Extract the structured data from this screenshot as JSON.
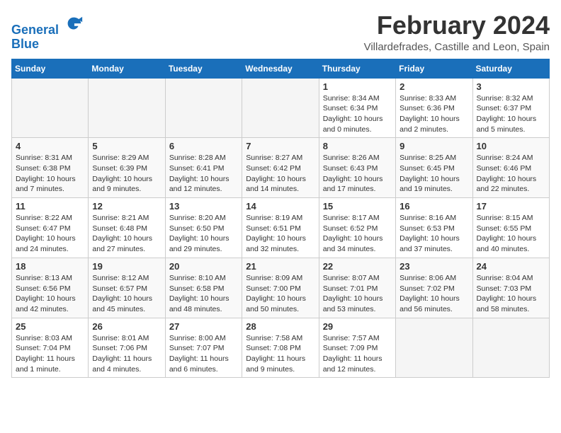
{
  "logo": {
    "line1": "General",
    "line2": "Blue"
  },
  "title": "February 2024",
  "subtitle": "Villardefrades, Castille and Leon, Spain",
  "weekdays": [
    "Sunday",
    "Monday",
    "Tuesday",
    "Wednesday",
    "Thursday",
    "Friday",
    "Saturday"
  ],
  "weeks": [
    [
      {
        "day": "",
        "info": ""
      },
      {
        "day": "",
        "info": ""
      },
      {
        "day": "",
        "info": ""
      },
      {
        "day": "",
        "info": ""
      },
      {
        "day": "1",
        "info": "Sunrise: 8:34 AM\nSunset: 6:34 PM\nDaylight: 10 hours and 0 minutes."
      },
      {
        "day": "2",
        "info": "Sunrise: 8:33 AM\nSunset: 6:36 PM\nDaylight: 10 hours and 2 minutes."
      },
      {
        "day": "3",
        "info": "Sunrise: 8:32 AM\nSunset: 6:37 PM\nDaylight: 10 hours and 5 minutes."
      }
    ],
    [
      {
        "day": "4",
        "info": "Sunrise: 8:31 AM\nSunset: 6:38 PM\nDaylight: 10 hours and 7 minutes."
      },
      {
        "day": "5",
        "info": "Sunrise: 8:29 AM\nSunset: 6:39 PM\nDaylight: 10 hours and 9 minutes."
      },
      {
        "day": "6",
        "info": "Sunrise: 8:28 AM\nSunset: 6:41 PM\nDaylight: 10 hours and 12 minutes."
      },
      {
        "day": "7",
        "info": "Sunrise: 8:27 AM\nSunset: 6:42 PM\nDaylight: 10 hours and 14 minutes."
      },
      {
        "day": "8",
        "info": "Sunrise: 8:26 AM\nSunset: 6:43 PM\nDaylight: 10 hours and 17 minutes."
      },
      {
        "day": "9",
        "info": "Sunrise: 8:25 AM\nSunset: 6:45 PM\nDaylight: 10 hours and 19 minutes."
      },
      {
        "day": "10",
        "info": "Sunrise: 8:24 AM\nSunset: 6:46 PM\nDaylight: 10 hours and 22 minutes."
      }
    ],
    [
      {
        "day": "11",
        "info": "Sunrise: 8:22 AM\nSunset: 6:47 PM\nDaylight: 10 hours and 24 minutes."
      },
      {
        "day": "12",
        "info": "Sunrise: 8:21 AM\nSunset: 6:48 PM\nDaylight: 10 hours and 27 minutes."
      },
      {
        "day": "13",
        "info": "Sunrise: 8:20 AM\nSunset: 6:50 PM\nDaylight: 10 hours and 29 minutes."
      },
      {
        "day": "14",
        "info": "Sunrise: 8:19 AM\nSunset: 6:51 PM\nDaylight: 10 hours and 32 minutes."
      },
      {
        "day": "15",
        "info": "Sunrise: 8:17 AM\nSunset: 6:52 PM\nDaylight: 10 hours and 34 minutes."
      },
      {
        "day": "16",
        "info": "Sunrise: 8:16 AM\nSunset: 6:53 PM\nDaylight: 10 hours and 37 minutes."
      },
      {
        "day": "17",
        "info": "Sunrise: 8:15 AM\nSunset: 6:55 PM\nDaylight: 10 hours and 40 minutes."
      }
    ],
    [
      {
        "day": "18",
        "info": "Sunrise: 8:13 AM\nSunset: 6:56 PM\nDaylight: 10 hours and 42 minutes."
      },
      {
        "day": "19",
        "info": "Sunrise: 8:12 AM\nSunset: 6:57 PM\nDaylight: 10 hours and 45 minutes."
      },
      {
        "day": "20",
        "info": "Sunrise: 8:10 AM\nSunset: 6:58 PM\nDaylight: 10 hours and 48 minutes."
      },
      {
        "day": "21",
        "info": "Sunrise: 8:09 AM\nSunset: 7:00 PM\nDaylight: 10 hours and 50 minutes."
      },
      {
        "day": "22",
        "info": "Sunrise: 8:07 AM\nSunset: 7:01 PM\nDaylight: 10 hours and 53 minutes."
      },
      {
        "day": "23",
        "info": "Sunrise: 8:06 AM\nSunset: 7:02 PM\nDaylight: 10 hours and 56 minutes."
      },
      {
        "day": "24",
        "info": "Sunrise: 8:04 AM\nSunset: 7:03 PM\nDaylight: 10 hours and 58 minutes."
      }
    ],
    [
      {
        "day": "25",
        "info": "Sunrise: 8:03 AM\nSunset: 7:04 PM\nDaylight: 11 hours and 1 minute."
      },
      {
        "day": "26",
        "info": "Sunrise: 8:01 AM\nSunset: 7:06 PM\nDaylight: 11 hours and 4 minutes."
      },
      {
        "day": "27",
        "info": "Sunrise: 8:00 AM\nSunset: 7:07 PM\nDaylight: 11 hours and 6 minutes."
      },
      {
        "day": "28",
        "info": "Sunrise: 7:58 AM\nSunset: 7:08 PM\nDaylight: 11 hours and 9 minutes."
      },
      {
        "day": "29",
        "info": "Sunrise: 7:57 AM\nSunset: 7:09 PM\nDaylight: 11 hours and 12 minutes."
      },
      {
        "day": "",
        "info": ""
      },
      {
        "day": "",
        "info": ""
      }
    ]
  ]
}
